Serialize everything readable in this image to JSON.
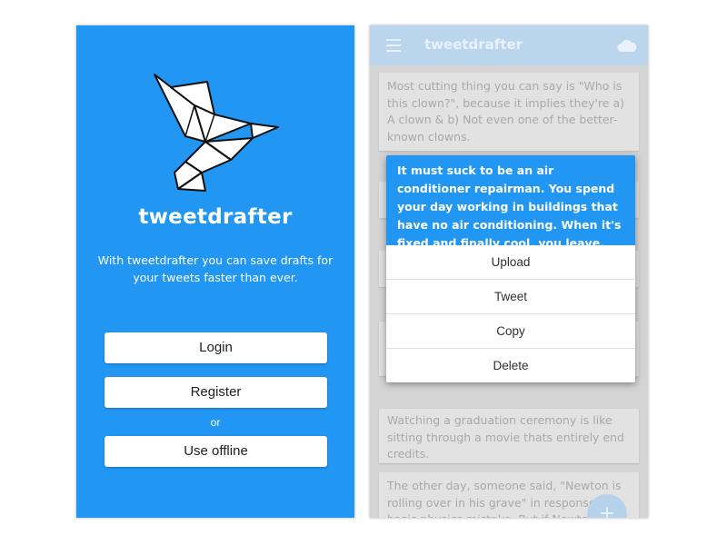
{
  "welcome": {
    "app_name": "tweetdrafter",
    "tagline": "With tweetdrafter you can save drafts for your tweets faster than ever.",
    "login_label": "Login",
    "register_label": "Register",
    "or_label": "or",
    "offline_label": "Use offline",
    "logo_icon": "origami-bird-logo"
  },
  "drafts_screen": {
    "appbar_title": "tweetdrafter",
    "menu_icon": "hamburger-menu-icon",
    "cloud_icon": "cloud-icon",
    "fab_label": "+",
    "drafts": [
      "Most cutting thing you can say is \"Who is this clown?\", because it implies they're a) A clown & b) Not even one of the better-known clowns.",
      "Watching a graduation ceremony is like sitting through a movie thats entirely end credits.",
      "The other day, someone said, \"Newton is rolling over in his grave\" in response to a basic physics mistake. But if Newton heard someone suggest his corpse could"
    ]
  },
  "popup": {
    "draft_text": "It must suck to be an air conditioner repairman. You spend your day working in buildings that have no air conditioning. When it's fixed and finally cool, you leave.",
    "actions": [
      "Upload",
      "Tweet",
      "Copy",
      "Delete"
    ]
  },
  "colors": {
    "primary": "#2196f3",
    "white": "#ffffff",
    "dim_overlay": "#d4d4d4"
  }
}
